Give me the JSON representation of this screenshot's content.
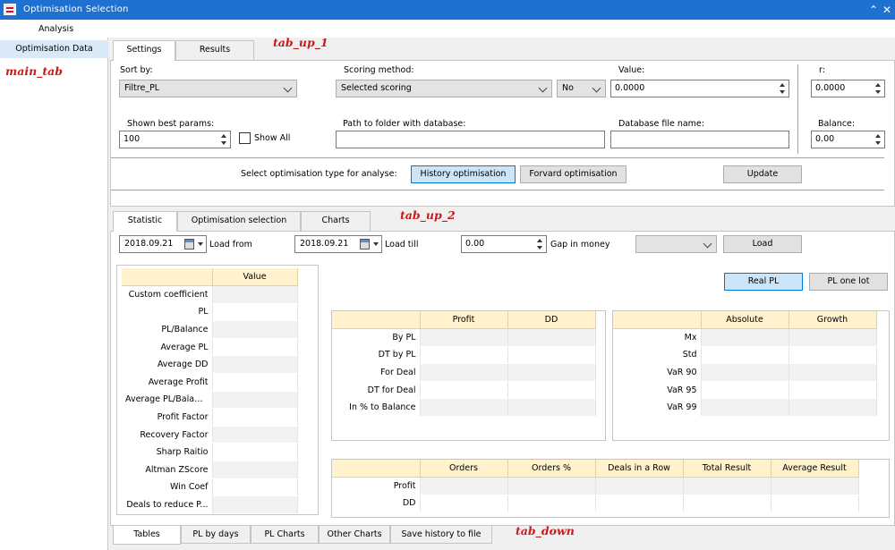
{
  "window": {
    "title": "Optimisation Selection",
    "collapse_icon": "chevron-up-icon",
    "close_icon": "close-icon"
  },
  "menu": {
    "analysis": "Analysis"
  },
  "left": {
    "item": "Optimisation Data",
    "annotation": "main_tab"
  },
  "tabs_up1": {
    "settings": "Settings",
    "results": "Results",
    "annotation": "tab_up_1"
  },
  "settings": {
    "sort_by_label": "Sort by:",
    "sort_by_value": "Filtre_PL",
    "scoring_label": "Scoring method:",
    "scoring_value": "Selected scoring",
    "no_value": "No",
    "value_label": "Value:",
    "value_value": "0.0000",
    "r_label": "r:",
    "r_value": "0.0000",
    "shown_label": "Shown best params:",
    "shown_value": "100",
    "show_all": "Show All",
    "path_label": "Path to folder with database:",
    "path_value": "",
    "dbfile_label": "Database file name:",
    "dbfile_value": "",
    "balance_label": "Balance:",
    "balance_value": "0.00",
    "select_type_label": "Select optimisation type for analyse:",
    "history_btn": "History optimisation",
    "forward_btn": "Forvard optimisation",
    "update_btn": "Update"
  },
  "tabs_up2": {
    "statistic": "Statistic",
    "optsel": "Optimisation selection",
    "charts": "Charts",
    "annotation": "tab_up_2"
  },
  "stat": {
    "date_from": "2018.09.21",
    "load_from": "Load from",
    "date_till": "2018.09.21",
    "load_till": "Load till",
    "gap_value": "0.00",
    "gap_label": "Gap in money",
    "combo_value": "",
    "load_btn": "Load",
    "real_pl": "Real PL",
    "pl_one_lot": "PL one lot"
  },
  "left_table": {
    "header": "Value",
    "rows": [
      "Custom coefficient",
      "PL",
      "PL/Balance",
      "Average PL",
      "Average DD",
      "Average Profit",
      "Average PL/Balance",
      "Profit Factor",
      "Recovery Factor",
      "Sharp Raitio",
      "Altman ZScore",
      "Win Coef",
      "Deals to reduce P..."
    ]
  },
  "pd_table": {
    "headers": [
      "Profit",
      "DD"
    ],
    "rows": [
      "By PL",
      "DT by PL",
      "For Deal",
      "DT for Deal",
      "In % to Balance"
    ]
  },
  "ag_table": {
    "headers": [
      "Absolute",
      "Growth"
    ],
    "rows": [
      "Mx",
      "Std",
      "VaR 90",
      "VaR 95",
      "VaR 99"
    ]
  },
  "orders_table": {
    "headers": [
      "Orders",
      "Orders %",
      "Deals in a Row",
      "Total Result",
      "Average Result"
    ],
    "rows": [
      "Profit",
      "DD"
    ]
  },
  "tabs_down": {
    "tables": "Tables",
    "pl_by_days": "PL by days",
    "pl_charts": "PL Charts",
    "other_charts": "Other Charts",
    "save_history": "Save history to file",
    "annotation": "tab_down"
  }
}
